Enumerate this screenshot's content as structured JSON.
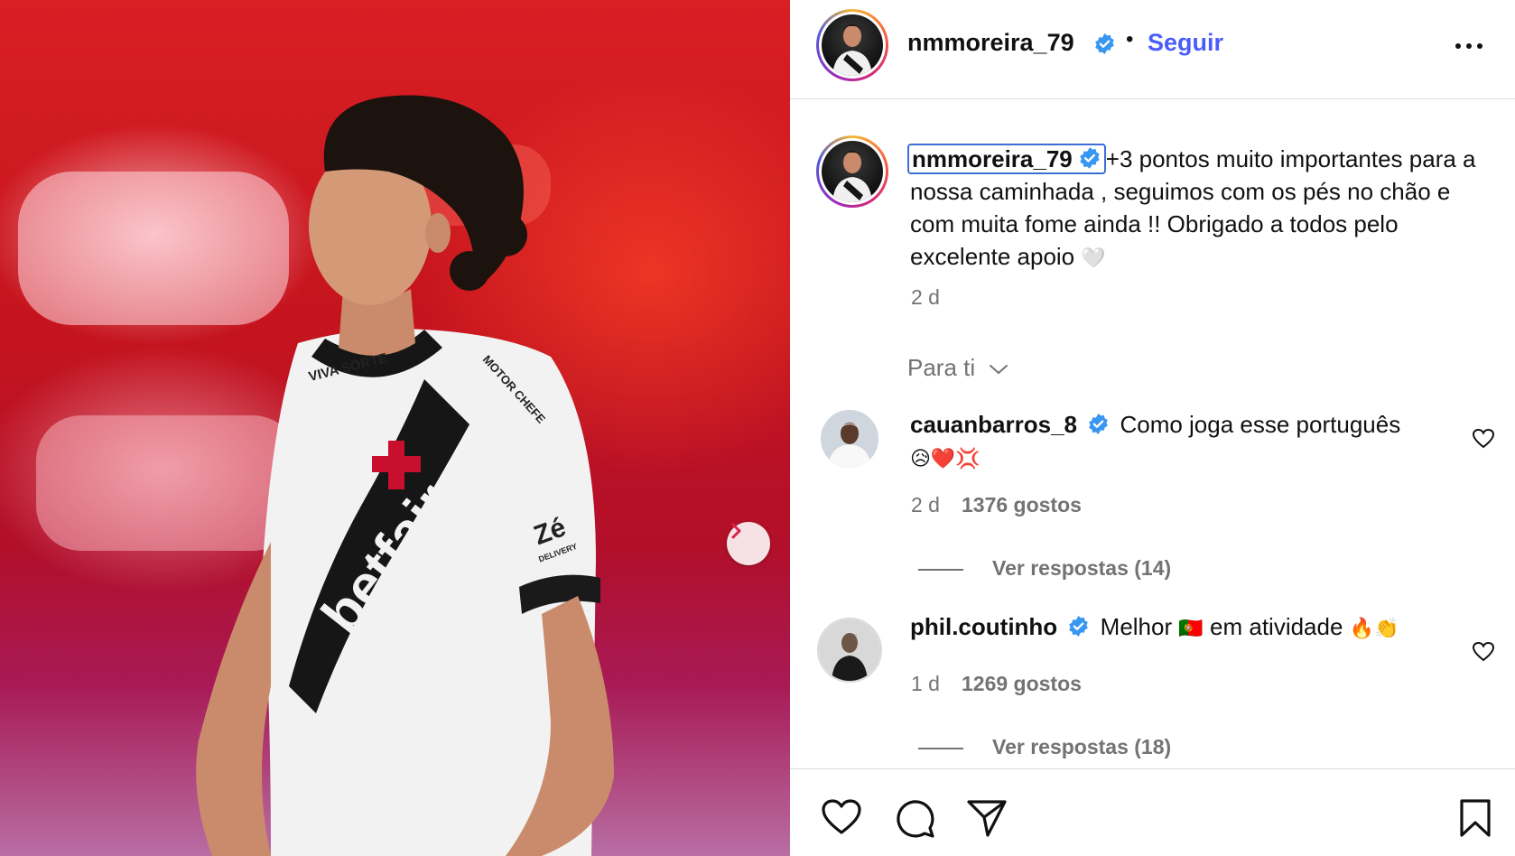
{
  "post": {
    "username": "nmmoreira_79",
    "verified": true,
    "follow_label": "Seguir",
    "caption": "+3 pontos muito importantes para a nossa caminhada , seguimos com os pés no chão e com muita fome ainda !! Obrigado a todos pelo excelente apoio",
    "caption_emoji": "🤍",
    "time": "2 d"
  },
  "photo": {
    "shirt_text_sponsor": "betfair",
    "shirt_text_chest": "VIVA SORTE",
    "shirt_text_sleeve": "Zé",
    "shirt_text_sleeve_sub": "DELIVERY",
    "shirt_text_shoulder": "MOTOR CHEFE"
  },
  "sort": {
    "label": "Para ti"
  },
  "comments": [
    {
      "username": "cauanbarros_8",
      "verified": true,
      "text": "Como joga esse português",
      "emoji": "😥❤️💢",
      "time": "2 d",
      "likes": "1376 gostos",
      "replies": "Ver respostas (14)"
    },
    {
      "username": "phil.coutinho",
      "verified": true,
      "text_before": "Melhor",
      "flag_emoji": "🇵🇹",
      "text_after": "em atividade",
      "emoji": "🔥👏",
      "time": "1 d",
      "likes": "1269 gostos",
      "replies": "Ver respostas (18)"
    }
  ],
  "icons": {
    "like": "heart-icon",
    "comment": "comment-icon",
    "share": "share-icon",
    "save": "bookmark-icon",
    "more": "more-icon",
    "next": "chevron-right-icon"
  },
  "colors": {
    "follow": "#4a5df9",
    "verified": "#3897f0",
    "secondary_text": "#737373"
  }
}
